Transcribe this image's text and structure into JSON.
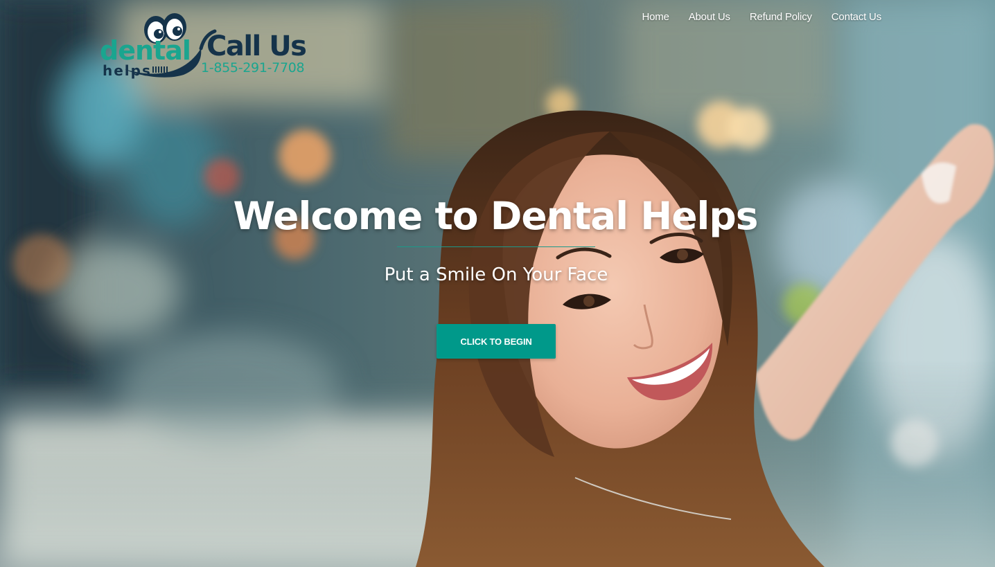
{
  "brand": {
    "logo_word_top": "dental",
    "logo_word_bottom": "helps",
    "call_label": "Call Us",
    "phone": "1-855-291-7708"
  },
  "nav": {
    "items": [
      {
        "label": "Home"
      },
      {
        "label": "About Us"
      },
      {
        "label": "Refund Policy"
      },
      {
        "label": "Contact Us"
      }
    ]
  },
  "hero": {
    "title": "Welcome to Dental Helps",
    "subtitle": "Put a Smile On Your Face",
    "cta_label": "CLICK TO BEGIN"
  },
  "colors": {
    "accent": "#00998a",
    "logo_teal": "#1aa58f",
    "logo_navy": "#15334a",
    "text_light": "#ffffff"
  }
}
